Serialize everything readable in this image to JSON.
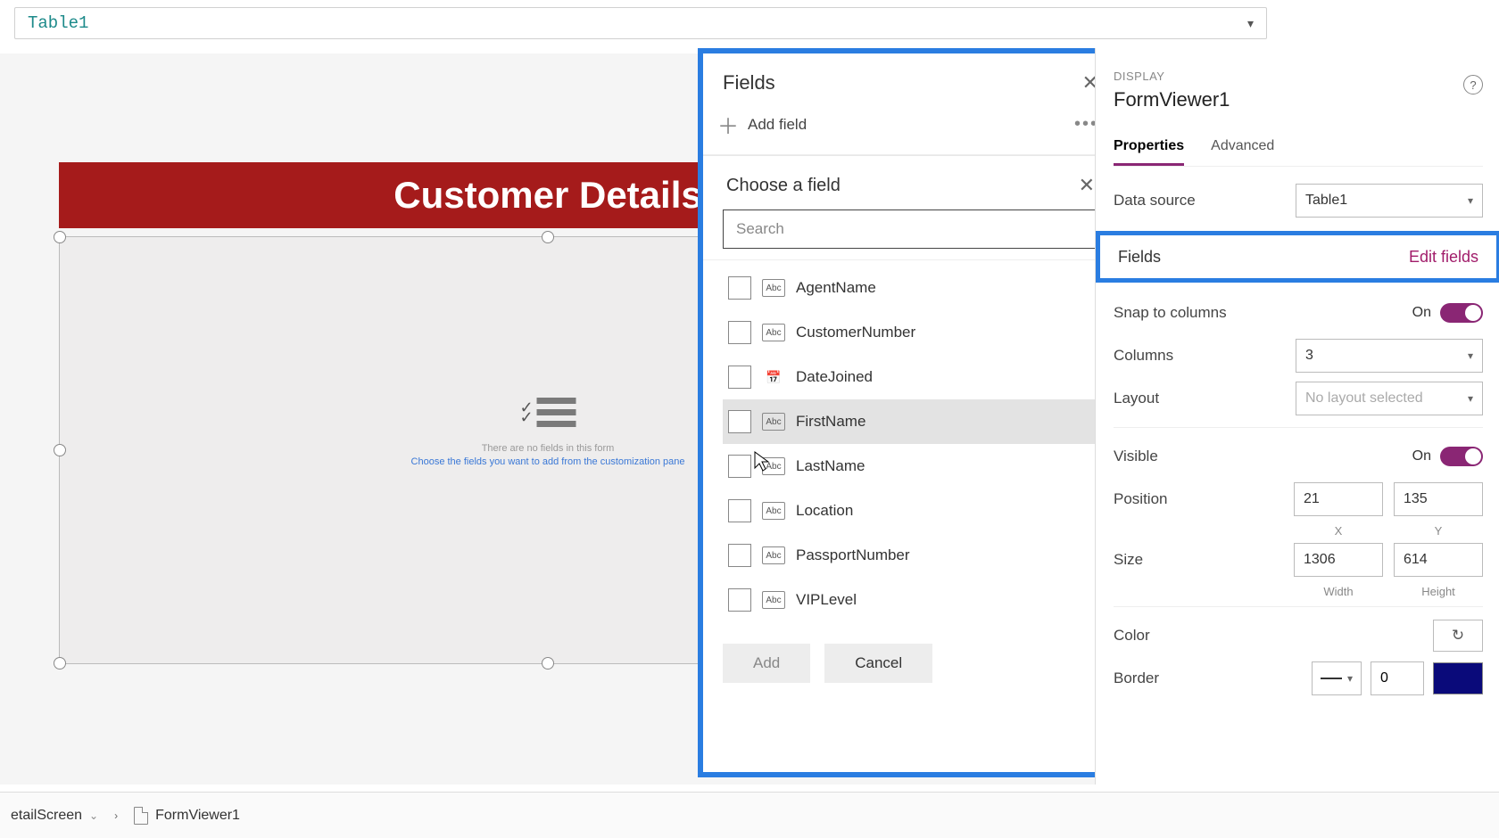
{
  "formula_bar": {
    "text": "Table1"
  },
  "canvas": {
    "form_title": "Customer Details",
    "empty_msg1": "There are no fields in this form",
    "empty_msg2": "Choose the fields you want to add from the customization pane"
  },
  "fields_panel": {
    "title": "Fields",
    "add_field": "Add field",
    "choose_title": "Choose a field",
    "search_placeholder": "Search",
    "items": [
      {
        "name": "AgentName",
        "type": "Abc"
      },
      {
        "name": "CustomerNumber",
        "type": "Abc"
      },
      {
        "name": "DateJoined",
        "type": "Date"
      },
      {
        "name": "FirstName",
        "type": "Abc",
        "hovered": true
      },
      {
        "name": "LastName",
        "type": "Abc"
      },
      {
        "name": "Location",
        "type": "Abc"
      },
      {
        "name": "PassportNumber",
        "type": "Abc"
      },
      {
        "name": "VIPLevel",
        "type": "Abc"
      }
    ],
    "add_btn": "Add",
    "cancel_btn": "Cancel"
  },
  "right_pane": {
    "section_label": "DISPLAY",
    "control_name": "FormViewer1",
    "tabs": {
      "properties": "Properties",
      "advanced": "Advanced"
    },
    "data_source_label": "Data source",
    "data_source_value": "Table1",
    "fields_label": "Fields",
    "edit_fields": "Edit fields",
    "snap_label": "Snap to columns",
    "snap_value": "On",
    "columns_label": "Columns",
    "columns_value": "3",
    "layout_label": "Layout",
    "layout_value": "No layout selected",
    "visible_label": "Visible",
    "visible_value": "On",
    "position_label": "Position",
    "position_x": "21",
    "position_y": "135",
    "x_label": "X",
    "y_label": "Y",
    "size_label": "Size",
    "size_w": "1306",
    "size_h": "614",
    "w_label": "Width",
    "h_label": "Height",
    "color_label": "Color",
    "border_label": "Border",
    "border_value": "0",
    "border_color": "#0a0a7a"
  },
  "crumbs": {
    "screen": "etailScreen",
    "control": "FormViewer1"
  }
}
